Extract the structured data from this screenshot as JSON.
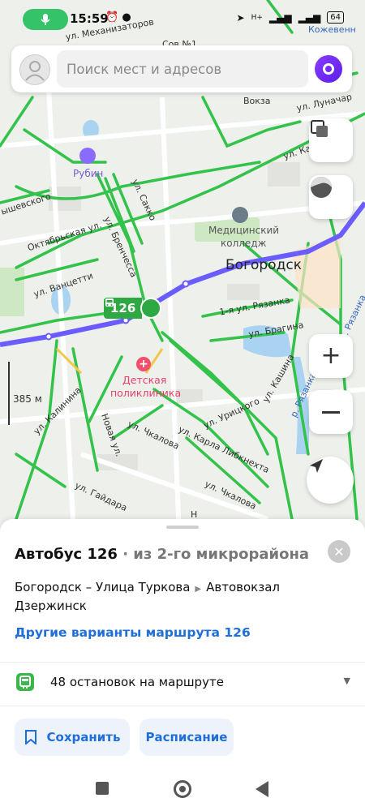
{
  "status": {
    "time": "15:59",
    "signal": "H+",
    "battery": "64"
  },
  "search": {
    "placeholder": "Поиск мест и адресов"
  },
  "map": {
    "scale": "385 м",
    "city_label": "Богородск",
    "poi_college": [
      "Медицинский",
      "колледж"
    ],
    "poi_hotel": "Рубин",
    "poi_clinic": [
      "Детская",
      "поликлиника"
    ],
    "bus_badge": "126",
    "streets": {
      "mechanizatorov": "ул. Механизаторов",
      "kozhevennaya": "Кожевенн",
      "lunacharskogo": "ул. Луначар",
      "karla_marksa": "ул. Карла М",
      "voksal": "Вокза",
      "sovetskaya": "Сов №1",
      "chernyshevskogo": "ышевского",
      "oktyabrskaya": "Октябрьская ул.",
      "vanzetti": "ул. Ванцетти",
      "sakko": "ул. Сакко",
      "brenchessa": "ул. Бренчесса",
      "ryazanka1": "1-я ул. Рязанка",
      "bragina": "ул. Брагина",
      "ryazanka": "р. Рязанка",
      "ryazanka2": "р. Рязанка",
      "kashina": "ул. Кашина",
      "uritskogo": "ул. Урицкого",
      "karla_libknekhta": "ул. Карла Либкнехта",
      "chkalova": "ул. Чкалова",
      "chkalova2": "ул. Чкалова",
      "kalinina": "ул. Калинина",
      "novaya": "Новая ул.",
      "gaidara": "ул. Гайдара",
      "nadya_hodyreva": "Н"
    }
  },
  "sheet": {
    "title": "Автобус 126",
    "subtitle": " · из 2-го микрорайона",
    "route_from": "Богородск – Улица Туркова",
    "route_to": "Автовокзал",
    "route_to2": "Дзержинск",
    "variants_link": "Другие варианты маршрута 126",
    "stops_label": "48 остановок на маршруте",
    "save_label": "Сохранить",
    "schedule_label": "Расписание"
  },
  "colors": {
    "traffic_green": "#33c24a",
    "route_blue": "#6a5cff",
    "accent": "#1e6fd9"
  }
}
